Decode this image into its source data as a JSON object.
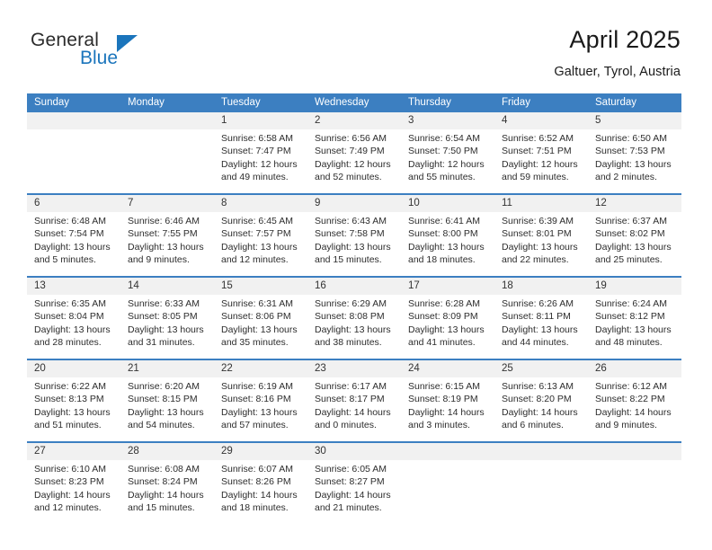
{
  "brand": {
    "word_one": "General",
    "word_two": "Blue",
    "accent_color": "#1b75bc"
  },
  "header": {
    "title": "April 2025",
    "subtitle": "Galtuer, Tyrol, Austria"
  },
  "calendar": {
    "header_color": "#3c7fc1",
    "daynum_band_color": "#f1f1f1",
    "weekday_names": [
      "Sunday",
      "Monday",
      "Tuesday",
      "Wednesday",
      "Thursday",
      "Friday",
      "Saturday"
    ],
    "weeks": [
      {
        "days": [
          {
            "num": "",
            "lines": []
          },
          {
            "num": "",
            "lines": []
          },
          {
            "num": "1",
            "lines": [
              "Sunrise: 6:58 AM",
              "Sunset: 7:47 PM",
              "Daylight: 12 hours",
              "and 49 minutes."
            ]
          },
          {
            "num": "2",
            "lines": [
              "Sunrise: 6:56 AM",
              "Sunset: 7:49 PM",
              "Daylight: 12 hours",
              "and 52 minutes."
            ]
          },
          {
            "num": "3",
            "lines": [
              "Sunrise: 6:54 AM",
              "Sunset: 7:50 PM",
              "Daylight: 12 hours",
              "and 55 minutes."
            ]
          },
          {
            "num": "4",
            "lines": [
              "Sunrise: 6:52 AM",
              "Sunset: 7:51 PM",
              "Daylight: 12 hours",
              "and 59 minutes."
            ]
          },
          {
            "num": "5",
            "lines": [
              "Sunrise: 6:50 AM",
              "Sunset: 7:53 PM",
              "Daylight: 13 hours",
              "and 2 minutes."
            ]
          }
        ]
      },
      {
        "days": [
          {
            "num": "6",
            "lines": [
              "Sunrise: 6:48 AM",
              "Sunset: 7:54 PM",
              "Daylight: 13 hours",
              "and 5 minutes."
            ]
          },
          {
            "num": "7",
            "lines": [
              "Sunrise: 6:46 AM",
              "Sunset: 7:55 PM",
              "Daylight: 13 hours",
              "and 9 minutes."
            ]
          },
          {
            "num": "8",
            "lines": [
              "Sunrise: 6:45 AM",
              "Sunset: 7:57 PM",
              "Daylight: 13 hours",
              "and 12 minutes."
            ]
          },
          {
            "num": "9",
            "lines": [
              "Sunrise: 6:43 AM",
              "Sunset: 7:58 PM",
              "Daylight: 13 hours",
              "and 15 minutes."
            ]
          },
          {
            "num": "10",
            "lines": [
              "Sunrise: 6:41 AM",
              "Sunset: 8:00 PM",
              "Daylight: 13 hours",
              "and 18 minutes."
            ]
          },
          {
            "num": "11",
            "lines": [
              "Sunrise: 6:39 AM",
              "Sunset: 8:01 PM",
              "Daylight: 13 hours",
              "and 22 minutes."
            ]
          },
          {
            "num": "12",
            "lines": [
              "Sunrise: 6:37 AM",
              "Sunset: 8:02 PM",
              "Daylight: 13 hours",
              "and 25 minutes."
            ]
          }
        ]
      },
      {
        "days": [
          {
            "num": "13",
            "lines": [
              "Sunrise: 6:35 AM",
              "Sunset: 8:04 PM",
              "Daylight: 13 hours",
              "and 28 minutes."
            ]
          },
          {
            "num": "14",
            "lines": [
              "Sunrise: 6:33 AM",
              "Sunset: 8:05 PM",
              "Daylight: 13 hours",
              "and 31 minutes."
            ]
          },
          {
            "num": "15",
            "lines": [
              "Sunrise: 6:31 AM",
              "Sunset: 8:06 PM",
              "Daylight: 13 hours",
              "and 35 minutes."
            ]
          },
          {
            "num": "16",
            "lines": [
              "Sunrise: 6:29 AM",
              "Sunset: 8:08 PM",
              "Daylight: 13 hours",
              "and 38 minutes."
            ]
          },
          {
            "num": "17",
            "lines": [
              "Sunrise: 6:28 AM",
              "Sunset: 8:09 PM",
              "Daylight: 13 hours",
              "and 41 minutes."
            ]
          },
          {
            "num": "18",
            "lines": [
              "Sunrise: 6:26 AM",
              "Sunset: 8:11 PM",
              "Daylight: 13 hours",
              "and 44 minutes."
            ]
          },
          {
            "num": "19",
            "lines": [
              "Sunrise: 6:24 AM",
              "Sunset: 8:12 PM",
              "Daylight: 13 hours",
              "and 48 minutes."
            ]
          }
        ]
      },
      {
        "days": [
          {
            "num": "20",
            "lines": [
              "Sunrise: 6:22 AM",
              "Sunset: 8:13 PM",
              "Daylight: 13 hours",
              "and 51 minutes."
            ]
          },
          {
            "num": "21",
            "lines": [
              "Sunrise: 6:20 AM",
              "Sunset: 8:15 PM",
              "Daylight: 13 hours",
              "and 54 minutes."
            ]
          },
          {
            "num": "22",
            "lines": [
              "Sunrise: 6:19 AM",
              "Sunset: 8:16 PM",
              "Daylight: 13 hours",
              "and 57 minutes."
            ]
          },
          {
            "num": "23",
            "lines": [
              "Sunrise: 6:17 AM",
              "Sunset: 8:17 PM",
              "Daylight: 14 hours",
              "and 0 minutes."
            ]
          },
          {
            "num": "24",
            "lines": [
              "Sunrise: 6:15 AM",
              "Sunset: 8:19 PM",
              "Daylight: 14 hours",
              "and 3 minutes."
            ]
          },
          {
            "num": "25",
            "lines": [
              "Sunrise: 6:13 AM",
              "Sunset: 8:20 PM",
              "Daylight: 14 hours",
              "and 6 minutes."
            ]
          },
          {
            "num": "26",
            "lines": [
              "Sunrise: 6:12 AM",
              "Sunset: 8:22 PM",
              "Daylight: 14 hours",
              "and 9 minutes."
            ]
          }
        ]
      },
      {
        "days": [
          {
            "num": "27",
            "lines": [
              "Sunrise: 6:10 AM",
              "Sunset: 8:23 PM",
              "Daylight: 14 hours",
              "and 12 minutes."
            ]
          },
          {
            "num": "28",
            "lines": [
              "Sunrise: 6:08 AM",
              "Sunset: 8:24 PM",
              "Daylight: 14 hours",
              "and 15 minutes."
            ]
          },
          {
            "num": "29",
            "lines": [
              "Sunrise: 6:07 AM",
              "Sunset: 8:26 PM",
              "Daylight: 14 hours",
              "and 18 minutes."
            ]
          },
          {
            "num": "30",
            "lines": [
              "Sunrise: 6:05 AM",
              "Sunset: 8:27 PM",
              "Daylight: 14 hours",
              "and 21 minutes."
            ]
          },
          {
            "num": "",
            "lines": []
          },
          {
            "num": "",
            "lines": []
          },
          {
            "num": "",
            "lines": []
          }
        ]
      }
    ]
  }
}
